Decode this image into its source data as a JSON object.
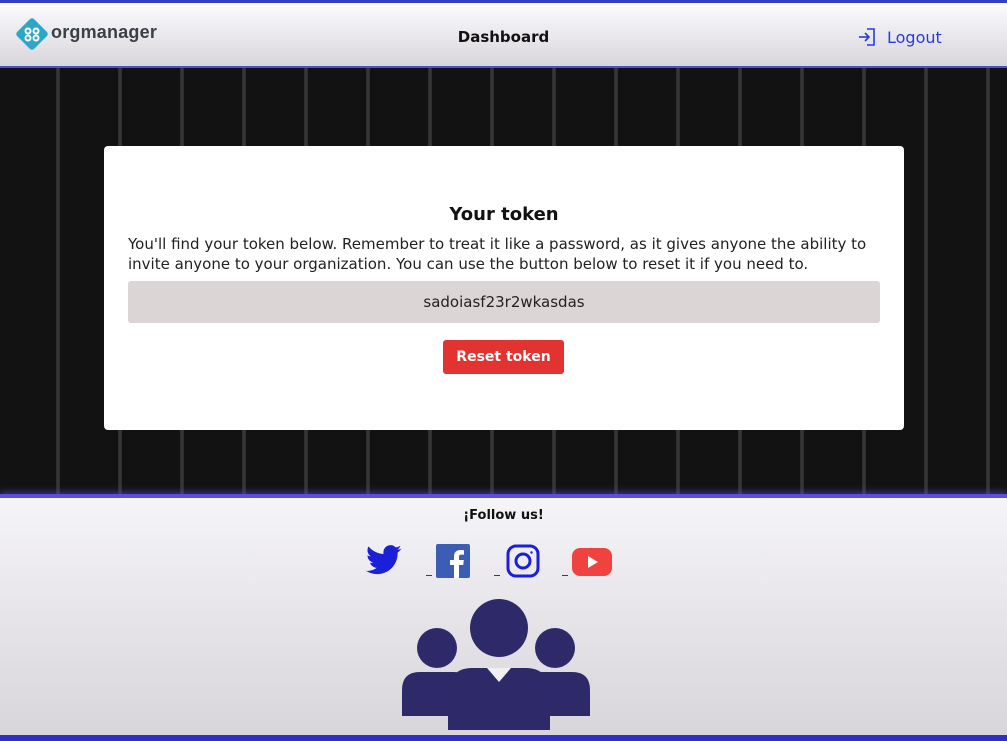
{
  "header": {
    "brand": "orgmanager",
    "title": "Dashboard",
    "logout_label": "Logout",
    "logo_icon": "diamond-logo-icon",
    "logout_icon": "sign-in-arrow-icon"
  },
  "card": {
    "title": "Your token",
    "description": "You'll find your token below. Remember to treat it like a password, as it gives anyone the ability to invite anyone to your organization. You can use the button below to reset it if you need to.",
    "token": "sadoiasf23r2wkasdas",
    "reset_label": "Reset token"
  },
  "footer": {
    "follow_label": "¡Follow us!",
    "socials": [
      "twitter-icon",
      "facebook-icon",
      "instagram-icon",
      "youtube-icon"
    ],
    "illustration": "team-people-icon"
  },
  "colors": {
    "accent": "#2a3bd9",
    "danger": "#e23331",
    "logo": "#2aa7c9",
    "people": "#2e2a6a"
  }
}
